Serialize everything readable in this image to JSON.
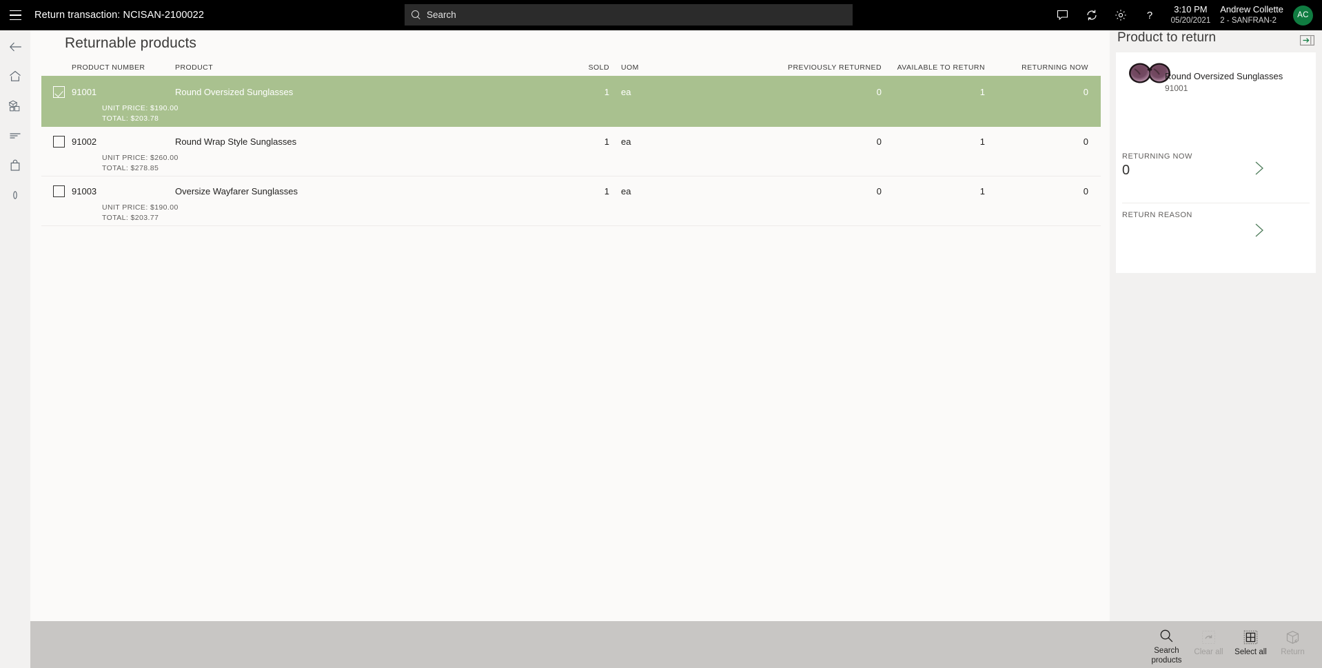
{
  "topbar": {
    "title": "Return transaction: NCISAN-2100022",
    "menu_icon": "hamburger-icon",
    "search_placeholder": "Search",
    "icons": [
      "chat-icon",
      "sync-icon",
      "settings-icon",
      "help-icon"
    ],
    "time": "3:10 PM",
    "date": "05/20/2021",
    "user_name": "Andrew Collette",
    "user_store": "2 - SANFRAN-2",
    "avatar_initials": "AC",
    "avatar_color": "#107c41"
  },
  "rail": {
    "items": [
      {
        "name": "back-icon"
      },
      {
        "name": "home-icon"
      },
      {
        "name": "products-icon"
      },
      {
        "name": "journal-icon"
      },
      {
        "name": "shopping-bag-icon"
      },
      {
        "name": "customer-icon"
      }
    ]
  },
  "page": {
    "title": "Returnable products"
  },
  "table": {
    "columns": [
      {
        "key": "check",
        "label": ""
      },
      {
        "key": "product_number",
        "label": "PRODUCT NUMBER"
      },
      {
        "key": "product",
        "label": "PRODUCT"
      },
      {
        "key": "sold",
        "label": "SOLD"
      },
      {
        "key": "uom",
        "label": "UOM"
      },
      {
        "key": "previously_returned",
        "label": "PREVIOUSLY RETURNED"
      },
      {
        "key": "available_to_return",
        "label": "AVAILABLE TO RETURN"
      },
      {
        "key": "returning_now",
        "label": "RETURNING NOW"
      }
    ],
    "rows": [
      {
        "selected": true,
        "product_number": "91001",
        "product": "Round Oversized Sunglasses",
        "sold": "1",
        "uom": "ea",
        "previously_returned": "0",
        "available_to_return": "1",
        "returning_now": "0",
        "unit_price": "UNIT PRICE: $190.00",
        "total": "TOTAL: $203.78"
      },
      {
        "selected": false,
        "product_number": "91002",
        "product": "Round Wrap Style Sunglasses",
        "sold": "1",
        "uom": "ea",
        "previously_returned": "0",
        "available_to_return": "1",
        "returning_now": "0",
        "unit_price": "UNIT PRICE: $260.00",
        "total": "TOTAL: $278.85"
      },
      {
        "selected": false,
        "product_number": "91003",
        "product": "Oversize Wayfarer Sunglasses",
        "sold": "1",
        "uom": "ea",
        "previously_returned": "0",
        "available_to_return": "1",
        "returning_now": "0",
        "unit_price": "UNIT PRICE: $190.00",
        "total": "TOTAL: $203.77"
      }
    ],
    "selection_color": "#a9c18f"
  },
  "right_panel": {
    "title": "Product to return",
    "expand_icon": "expand-panel-icon",
    "product": {
      "name": "Round Oversized Sunglasses",
      "number": "91001",
      "image": "sunglasses-image"
    },
    "fields": [
      {
        "label": "RETURNING NOW",
        "value": "0",
        "chevron": "chevron-right-icon"
      },
      {
        "label": "RETURN REASON",
        "value": "",
        "chevron": "chevron-right-icon"
      }
    ]
  },
  "bottom_bar": {
    "buttons": [
      {
        "label": "Search\nproducts",
        "icon": "search-icon",
        "disabled": false
      },
      {
        "label": "Clear all",
        "icon": "clear-icon",
        "disabled": true
      },
      {
        "label": "Select all",
        "icon": "select-all-icon",
        "disabled": false
      },
      {
        "label": "Return",
        "icon": "return-box-icon",
        "disabled": true
      }
    ]
  }
}
